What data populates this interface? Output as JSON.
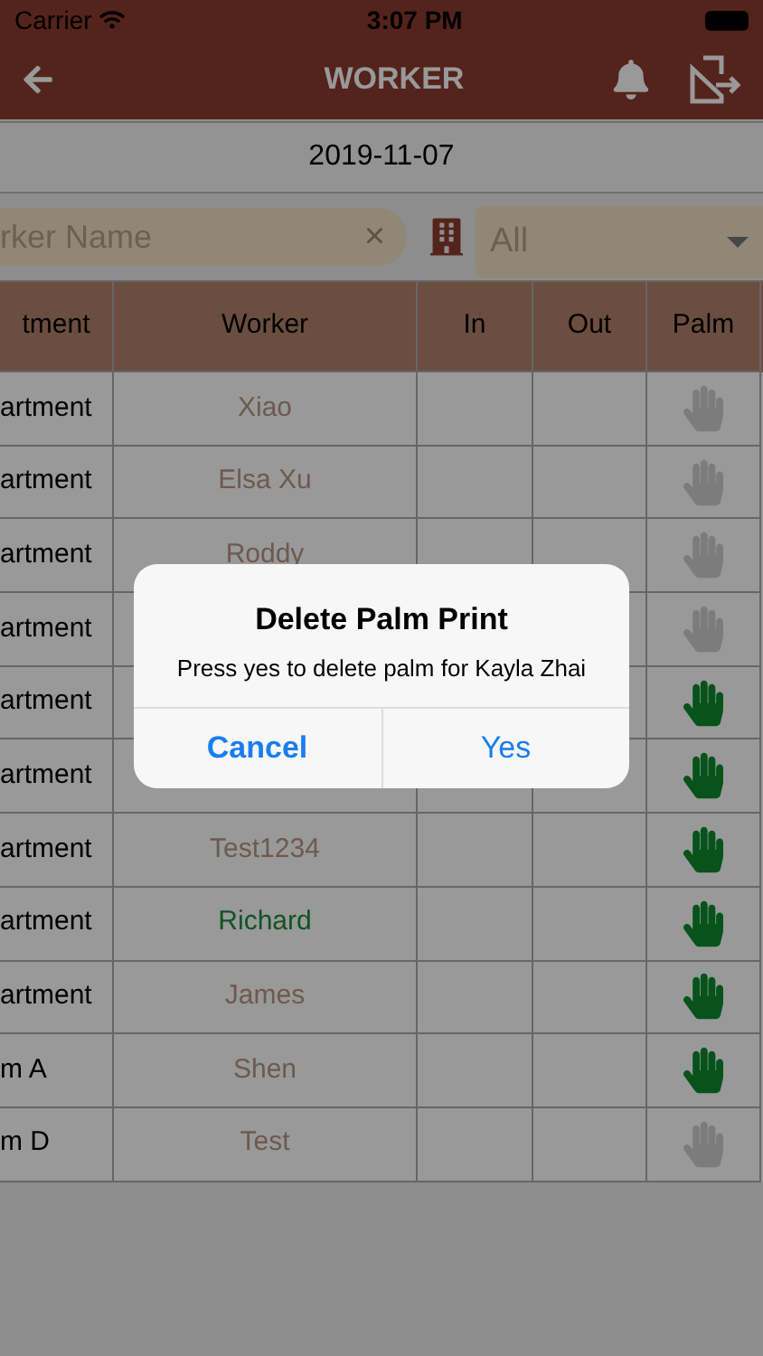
{
  "status_bar": {
    "carrier": "Carrier",
    "time": "3:07 PM"
  },
  "nav": {
    "title": "WORKER"
  },
  "date": "2019-11-07",
  "search": {
    "placeholder": "rker Name",
    "clear": "×"
  },
  "filter": {
    "value": "All"
  },
  "table": {
    "columns": [
      "tment",
      "Worker",
      "In",
      "Out",
      "Palm"
    ],
    "rows": [
      {
        "department": "artment",
        "worker": "Xiao",
        "highlighted": false,
        "palm": false
      },
      {
        "department": "artment",
        "worker": "Elsa Xu",
        "highlighted": false,
        "palm": false
      },
      {
        "department": "artment",
        "worker": "Roddy",
        "highlighted": false,
        "palm": false
      },
      {
        "department": "artment",
        "palm": false
      },
      {
        "department": "artment",
        "palm": true
      },
      {
        "department": "artment",
        "palm": true
      },
      {
        "department": "artment",
        "worker": "Test1234",
        "highlighted": false,
        "palm": true
      },
      {
        "department": "artment",
        "worker": "Richard",
        "highlighted": true,
        "palm": true
      },
      {
        "department": "artment",
        "worker": "James",
        "highlighted": false,
        "palm": true
      },
      {
        "department": "m A",
        "worker": "Shen",
        "highlighted": false,
        "palm": true
      },
      {
        "department": "m D",
        "worker": "Test",
        "highlighted": false,
        "palm": false
      }
    ]
  },
  "dialog": {
    "title": "Delete Palm Print",
    "message": "Press yes to delete palm for Kayla Zhai",
    "buttons": [
      "Cancel",
      "Yes"
    ]
  }
}
